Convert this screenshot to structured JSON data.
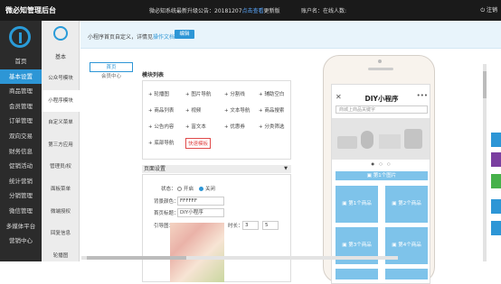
{
  "topbar": {
    "brand": "微必知管理后台",
    "notice_prefix": "微必知系统最新升级公告：",
    "notice_date": "20181207",
    "notice_highlight": "点击查看",
    "notice_suffix": "更新版",
    "user": "账户名：在线人数:",
    "logout": "注销"
  },
  "leftnav": {
    "items": [
      "首页",
      "基本设置",
      "商品管理",
      "会员管理",
      "订单管理",
      "双向交易",
      "财务信息",
      "促销活动",
      "统计营销",
      "分销管理",
      "微信管理",
      "多媒体平台",
      "营销中心"
    ],
    "active": "基本设置"
  },
  "subnav": {
    "title": "基本",
    "items": [
      "公众号模块",
      "小程序模块",
      "自定义菜单",
      "第三方应用",
      "管理员/权",
      "面板菜单",
      "微端授权",
      "回复信息",
      "轮播图"
    ],
    "active": "小程序模块"
  },
  "tipbar": {
    "text": "小程序首页自定义，详情见",
    "link": "操作文档",
    "edit": "编辑"
  },
  "lefttabs": [
    "首页",
    "会员中心"
  ],
  "modules": {
    "title": "模块列表",
    "items": [
      [
        "+ 轮播图",
        "+ 图片导航",
        "+ 分割线",
        "+ 辅助空白"
      ],
      [
        "+ 商品列表",
        "+ 视频",
        "+ 文本导航",
        "+ 商品搜索"
      ],
      [
        "+ 公告内容",
        "+ 富文本",
        "+ 优惠券",
        "+ 分类筛选"
      ],
      [
        "+ 底部导航",
        "快速模板"
      ]
    ]
  },
  "page_settings": {
    "title": "页面设置",
    "status_label": "状态：",
    "status_on": "开启",
    "status_off": "关闭",
    "bg_label": "背景颜色：",
    "bg_value": "FFFFFF",
    "title_label": "首页标题：",
    "title_value": "DIY小程序",
    "image_label": "引导图：",
    "duration_label": "时长：",
    "duration_min": "3",
    "duration_max": "5"
  },
  "phone": {
    "title": "DIY小程序",
    "close": "✕",
    "more": "•••",
    "search_placeholder": "商城上商品关键字",
    "category_bar": "第1个图片",
    "products": [
      "第1个商品",
      "第2个商品",
      "第3个商品",
      "第4个商品"
    ],
    "dots": "● ○ ○"
  },
  "colors": {
    "accent": "#2d96d6",
    "topbar": "#1a1a1a",
    "leftnav": "#2b2b2b",
    "product": "#7ec3ea",
    "side_tools": [
      "#2d96d6",
      "#7a3fa0",
      "#46b14a",
      "#2d96d6",
      "#2d96d6"
    ]
  }
}
